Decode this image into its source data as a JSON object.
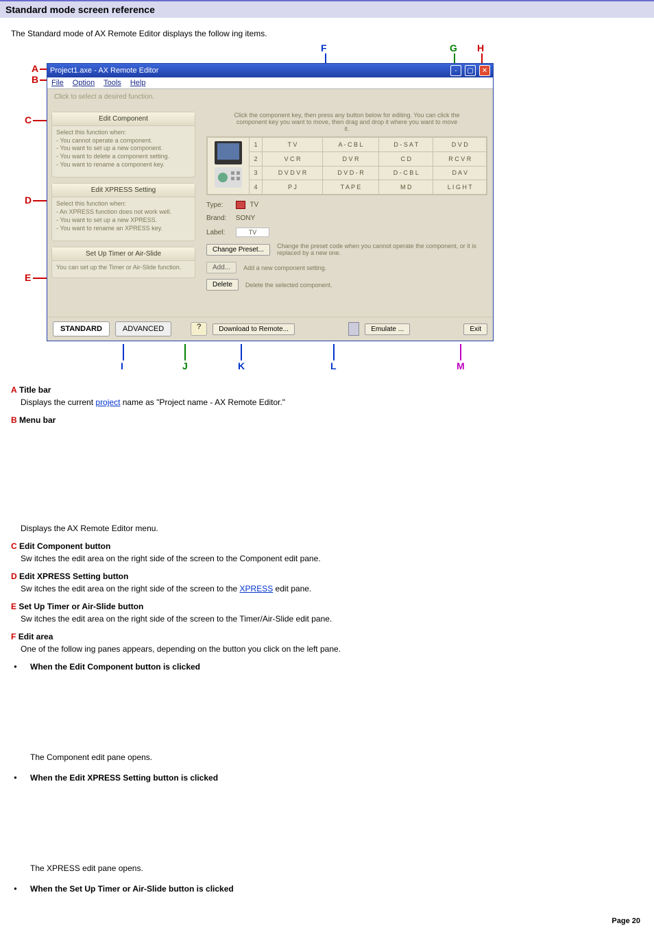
{
  "header": {
    "title": "Standard mode screen reference"
  },
  "intro": "The Standard mode of AX Remote Editor displays the follow ing items.",
  "diagram": {
    "labels": {
      "A": "A",
      "B": "B",
      "C": "C",
      "D": "D",
      "E": "E",
      "F": "F",
      "G": "G",
      "H": "H",
      "I": "I",
      "J": "J",
      "K": "K",
      "L": "L",
      "M": "M"
    },
    "window": {
      "title": "Project1.axe - AX Remote Editor",
      "menu": {
        "file": "File",
        "option": "Option",
        "tools": "Tools",
        "help": "Help"
      },
      "hint_top": "Click to select a desired function."
    },
    "left": {
      "card1": {
        "title": "Edit Component",
        "l0": "Select this function when:",
        "l1": "- You cannot operate a component.",
        "l2": "- You want to set up a new component.",
        "l3": "- You want to delete a component setting.",
        "l4": "- You want to rename a component key."
      },
      "card2": {
        "title": "Edit XPRESS Setting",
        "l0": "Select this function when:",
        "l1": "- An XPRESS function does not work well.",
        "l2": "- You want to set up a new XPRESS.",
        "l3": "- You want to rename an XPRESS key."
      },
      "card3": {
        "title": "Set Up Timer or Air-Slide",
        "l0": "You can set up the Timer or Air-Slide function."
      }
    },
    "right": {
      "hint": "Click the component key, then press any button below for editing. You can click the component key you want to move, then drag and drop it where you want to move it.",
      "rows": [
        {
          "i": "1",
          "c": [
            "T V",
            "A - C B L",
            "D - S A T",
            "D V D"
          ]
        },
        {
          "i": "2",
          "c": [
            "V C R",
            "D V R",
            "C D",
            "R C V R"
          ]
        },
        {
          "i": "3",
          "c": [
            "D V D V R",
            "D V D - R",
            "D - C B L",
            "D A V"
          ]
        },
        {
          "i": "4",
          "c": [
            "P J",
            "T A P E",
            "M D",
            "L I G H T"
          ]
        }
      ],
      "type_lbl": "Type:",
      "type_val": "TV",
      "brand_lbl": "Brand:",
      "brand_val": "SONY",
      "label_lbl": "Label:",
      "label_val": "TV",
      "change_btn": "Change Preset...",
      "change_txt": "Change the preset code when you cannot operate the component, or it is replaced by a new one.",
      "add_btn": "Add...",
      "add_txt": "Add a new component setting.",
      "del_btn": "Delete",
      "del_txt": "Delete the selected component."
    },
    "bottom": {
      "standard": "STANDARD",
      "advanced": "ADVANCED",
      "download": "Download to Remote...",
      "emulate": "Emulate ...",
      "exit": "Exit"
    }
  },
  "desc": {
    "A": {
      "k": "A",
      "t": "Title bar",
      "d_pre": "Displays the current ",
      "d_link": "project",
      "d_post": " name as \"Project name - AX Remote Editor.\""
    },
    "B": {
      "k": "B",
      "t": "Menu bar",
      "d": "Displays the AX Remote Editor menu."
    },
    "C": {
      "k": "C",
      "t": "Edit Component button",
      "d": "Sw itches the edit area on the right side of the screen to the Component edit pane."
    },
    "D": {
      "k": "D",
      "t": "Edit XPRESS Setting button",
      "d_pre": "Sw itches the edit area on the right side of the screen to the ",
      "d_link": "XPRESS",
      "d_post": " edit pane."
    },
    "E": {
      "k": "E",
      "t": "Set Up Timer or Air-Slide button",
      "d": "Sw itches the edit area on the right side of the screen to the Timer/Air-Slide edit pane."
    },
    "F": {
      "k": "F",
      "t": "Edit area",
      "d": "One of the follow ing panes appears, depending on the button you click on the left pane."
    }
  },
  "bullets": {
    "b1": "When the Edit Component button is clicked",
    "b1s": "The Component edit pane opens.",
    "b2": "When the Edit XPRESS Setting button is clicked",
    "b2s": "The XPRESS edit pane opens.",
    "b3": "When the Set Up Timer or Air-Slide button is clicked"
  },
  "footer": "Page 20"
}
